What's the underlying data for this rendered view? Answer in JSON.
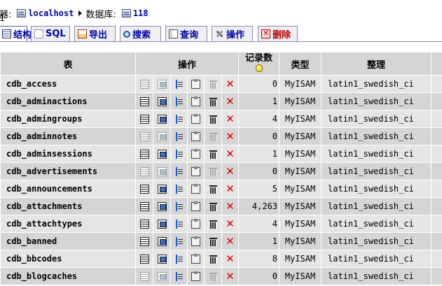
{
  "breadcrumb": {
    "prefix": "器:",
    "server_link": "localhost",
    "db_label": "数据库:",
    "db_link": "118"
  },
  "tabs": [
    {
      "id": "structure",
      "label": "结构",
      "icon": "structure-icon",
      "active": true
    },
    {
      "id": "sql",
      "label": "SQL",
      "icon": "sql-icon",
      "active": false
    },
    {
      "id": "export",
      "label": "导出",
      "icon": "export-icon",
      "active": false
    },
    {
      "id": "search",
      "label": "搜索",
      "icon": "search-icon",
      "active": false
    },
    {
      "id": "query",
      "label": "查询",
      "icon": "query-icon",
      "active": false
    },
    {
      "id": "operations",
      "label": "操作",
      "icon": "operations-icon",
      "active": false
    },
    {
      "id": "drop",
      "label": "删除",
      "icon": "drop-icon",
      "active": false
    }
  ],
  "table": {
    "headers": {
      "table": "表",
      "actions": "操作",
      "records": "记录数",
      "type": "类型",
      "collation": "整理"
    },
    "rows": [
      {
        "name": "cdb_access",
        "records": "0",
        "type": "MyISAM",
        "collation": "latin1_swedish_ci",
        "empty": true
      },
      {
        "name": "cdb_adminactions",
        "records": "1",
        "type": "MyISAM",
        "collation": "latin1_swedish_ci",
        "empty": false
      },
      {
        "name": "cdb_admingroups",
        "records": "4",
        "type": "MyISAM",
        "collation": "latin1_swedish_ci",
        "empty": false
      },
      {
        "name": "cdb_adminnotes",
        "records": "0",
        "type": "MyISAM",
        "collation": "latin1_swedish_ci",
        "empty": true
      },
      {
        "name": "cdb_adminsessions",
        "records": "1",
        "type": "MyISAM",
        "collation": "latin1_swedish_ci",
        "empty": false
      },
      {
        "name": "cdb_advertisements",
        "records": "0",
        "type": "MyISAM",
        "collation": "latin1_swedish_ci",
        "empty": true
      },
      {
        "name": "cdb_announcements",
        "records": "5",
        "type": "MyISAM",
        "collation": "latin1_swedish_ci",
        "empty": false
      },
      {
        "name": "cdb_attachments",
        "records": "4,263",
        "type": "MyISAM",
        "collation": "latin1_swedish_ci",
        "empty": false
      },
      {
        "name": "cdb_attachtypes",
        "records": "4",
        "type": "MyISAM",
        "collation": "latin1_swedish_ci",
        "empty": false
      },
      {
        "name": "cdb_banned",
        "records": "1",
        "type": "MyISAM",
        "collation": "latin1_swedish_ci",
        "empty": false
      },
      {
        "name": "cdb_bbcodes",
        "records": "8",
        "type": "MyISAM",
        "collation": "latin1_swedish_ci",
        "empty": false
      },
      {
        "name": "cdb_blogcaches",
        "records": "0",
        "type": "MyISAM",
        "collation": "latin1_swedish_ci",
        "empty": true
      }
    ]
  }
}
